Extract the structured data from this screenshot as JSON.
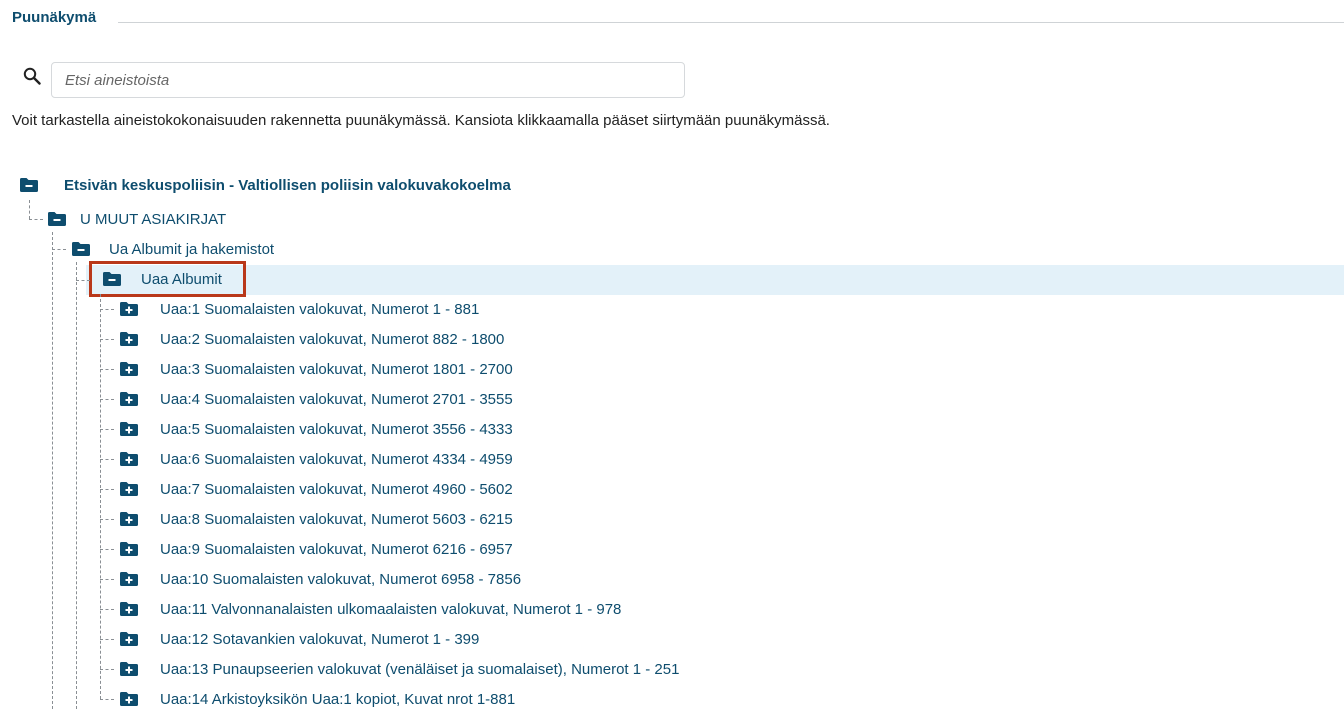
{
  "section": {
    "title": "Puunäkymä"
  },
  "search": {
    "placeholder": "Etsi aineistoista",
    "value": ""
  },
  "help_text": "Voit tarkastella aineistokokonaisuuden rakennetta puunäkymässä. Kansiota klikkaamalla pääset siirtymään puunäkymässä.",
  "colors": {
    "link": "#0e4d6e",
    "highlight": "#e3f1f9",
    "focus": "#b9381a"
  },
  "tree": {
    "root": {
      "label": "Etsivän keskuspoliisin - Valtiollisen poliisin valokuvakokoelma",
      "state": "expanded",
      "icon": "folder-minus-icon"
    },
    "level1": {
      "label": "U MUUT ASIAKIRJAT",
      "state": "expanded",
      "icon": "folder-minus-icon"
    },
    "level2": {
      "label": "Ua Albumit ja hakemistot",
      "state": "expanded",
      "icon": "folder-minus-icon"
    },
    "selected": {
      "label": "Uaa Albumit",
      "state": "expanded",
      "icon": "folder-minus-icon"
    },
    "children": [
      {
        "label": "Uaa:1 Suomalaisten valokuvat, Numerot 1 - 881"
      },
      {
        "label": "Uaa:2 Suomalaisten valokuvat, Numerot 882 - 1800"
      },
      {
        "label": "Uaa:3 Suomalaisten valokuvat, Numerot 1801 - 2700"
      },
      {
        "label": "Uaa:4 Suomalaisten valokuvat, Numerot 2701 - 3555"
      },
      {
        "label": "Uaa:5 Suomalaisten valokuvat, Numerot 3556 - 4333"
      },
      {
        "label": "Uaa:6 Suomalaisten valokuvat, Numerot 4334 - 4959"
      },
      {
        "label": "Uaa:7 Suomalaisten valokuvat, Numerot 4960 - 5602"
      },
      {
        "label": "Uaa:8 Suomalaisten valokuvat, Numerot 5603 - 6215"
      },
      {
        "label": "Uaa:9 Suomalaisten valokuvat, Numerot 6216 - 6957"
      },
      {
        "label": "Uaa:10 Suomalaisten valokuvat, Numerot 6958 - 7856"
      },
      {
        "label": "Uaa:11 Valvonnanalaisten ulkomaalaisten valokuvat, Numerot 1 - 978"
      },
      {
        "label": "Uaa:12 Sotavankien valokuvat, Numerot 1 - 399"
      },
      {
        "label": "Uaa:13 Punaupseerien valokuvat (venäläiset ja suomalaiset), Numerot 1 - 251"
      },
      {
        "label": "Uaa:14 Arkistoyksikön Uaa:1 kopiot, Kuvat nrot 1-881"
      }
    ]
  }
}
